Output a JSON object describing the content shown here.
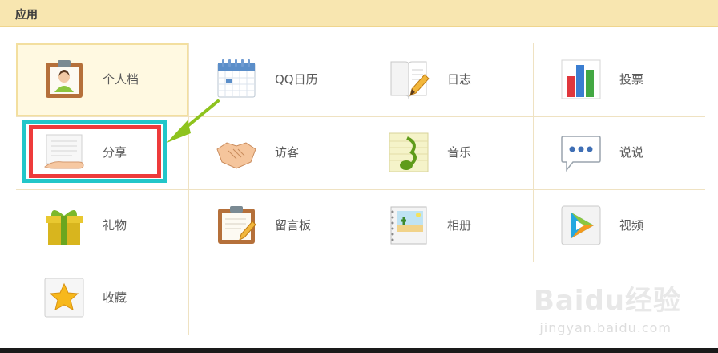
{
  "header": {
    "title": "应用"
  },
  "apps": [
    {
      "label": "个人档",
      "icon": "profile-clipboard-icon"
    },
    {
      "label": "QQ日历",
      "icon": "calendar-icon"
    },
    {
      "label": "日志",
      "icon": "diary-notebook-icon"
    },
    {
      "label": "投票",
      "icon": "vote-bar-chart-icon"
    },
    {
      "label": "分享",
      "icon": "share-hand-document-icon"
    },
    {
      "label": "访客",
      "icon": "visitor-handshake-icon"
    },
    {
      "label": "音乐",
      "icon": "music-note-icon"
    },
    {
      "label": "说说",
      "icon": "speech-bubble-icon"
    },
    {
      "label": "礼物",
      "icon": "gift-box-icon"
    },
    {
      "label": "留言板",
      "icon": "message-board-clipboard-icon"
    },
    {
      "label": "相册",
      "icon": "photo-album-icon"
    },
    {
      "label": "视频",
      "icon": "video-play-icon"
    },
    {
      "label": "收藏",
      "icon": "star-favorite-icon"
    }
  ],
  "watermark": {
    "main": "Baidu经验",
    "sub": "jingyan.baidu.com"
  },
  "colors": {
    "header_bg": "#f8e6b0",
    "cyan_annotation": "#22c6c9",
    "red_annotation": "#ee3b3b",
    "arrow": "#8ec31e"
  }
}
